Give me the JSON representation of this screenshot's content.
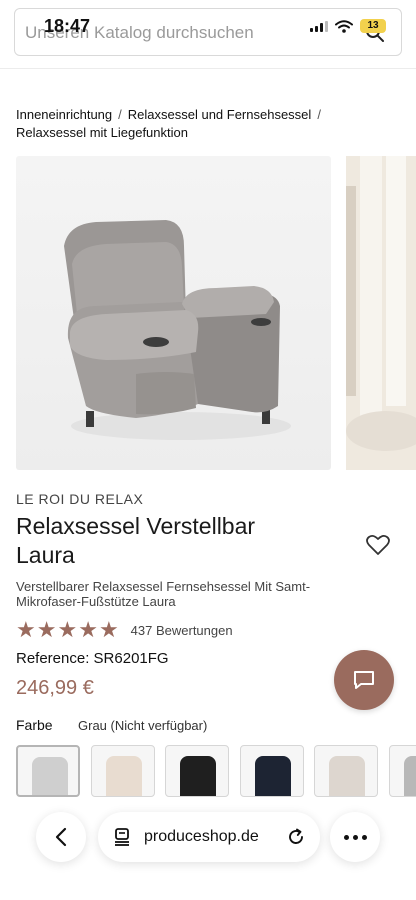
{
  "status": {
    "time": "18:47",
    "battery": "13"
  },
  "search": {
    "placeholder": "Unseren Katalog durchsuchen"
  },
  "breadcrumb": {
    "items": [
      "Inneneinrichtung",
      "Relaxsessel und Fernsehsessel",
      "Relaxsessel mit Liegefunktion"
    ],
    "separator": "/"
  },
  "product": {
    "brand": "LE ROI DU RELAX",
    "title": "Relaxsessel Verstellbar Laura",
    "subtitle": "Verstellbarer Relaxsessel Fernsehsessel Mit Samt-Mikrofaser-Fußstütze Laura",
    "rating": 5,
    "reviews": "437 Bewertungen",
    "reference": "Reference: SR6201FG",
    "price": "246,99 €",
    "color_label": "Farbe",
    "color_value": "Grau (Nicht verfügbar)"
  },
  "swatches": [
    {
      "color": "#cfcfcf"
    },
    {
      "color": "#e8dcd0"
    },
    {
      "color": "#1f1f1f"
    },
    {
      "color": "#1d2433"
    },
    {
      "color": "#ddd6cf"
    },
    {
      "color": "#b8b8b8"
    }
  ],
  "browser": {
    "url": "produceshop.de"
  },
  "colors": {
    "accent": "#9a6b5e"
  }
}
